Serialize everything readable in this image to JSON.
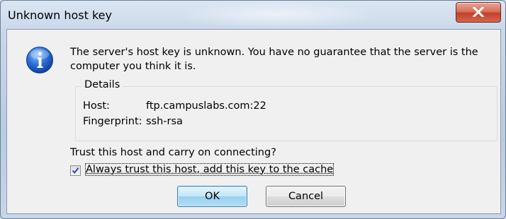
{
  "window": {
    "title": "Unknown host key",
    "close_icon": "close-x-icon"
  },
  "dialog": {
    "icon": "info-icon",
    "message": "The server's host key is unknown. You have no guarantee that the server is the computer you think it is.",
    "details": {
      "legend": "Details",
      "host_label": "Host:",
      "host_value": "ftp.campuslabs.com:22",
      "fingerprint_label": "Fingerprint:",
      "fingerprint_value": "ssh-rsa"
    },
    "question": "Trust this host and carry on connecting?",
    "always_trust": {
      "label": "Always trust this host, add this key to the cache",
      "checked": true
    },
    "buttons": {
      "ok": "OK",
      "cancel": "Cancel"
    }
  }
}
